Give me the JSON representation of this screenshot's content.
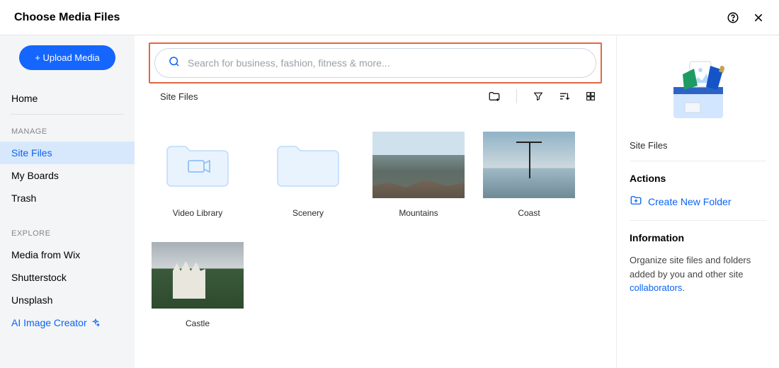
{
  "header": {
    "title": "Choose Media Files"
  },
  "sidebar": {
    "upload_label": "+ Upload Media",
    "home_label": "Home",
    "manage_label": "MANAGE",
    "manage_items": [
      {
        "label": "Site Files",
        "active": true
      },
      {
        "label": "My Boards"
      },
      {
        "label": "Trash"
      }
    ],
    "explore_label": "EXPLORE",
    "explore_items": [
      {
        "label": "Media from Wix"
      },
      {
        "label": "Shutterstock"
      },
      {
        "label": "Unsplash"
      },
      {
        "label": "AI Image Creator",
        "spark": true
      }
    ]
  },
  "search": {
    "placeholder": "Search for business, fashion, fitness & more..."
  },
  "toolbar": {
    "crumb": "Site Files"
  },
  "grid": {
    "items": [
      {
        "label": "Video Library",
        "kind": "folder-video"
      },
      {
        "label": "Scenery",
        "kind": "folder"
      },
      {
        "label": "Mountains",
        "kind": "image-mountains"
      },
      {
        "label": "Coast",
        "kind": "image-coast"
      },
      {
        "label": "Castle",
        "kind": "image-castle"
      }
    ]
  },
  "panel": {
    "title": "Site Files",
    "actions_heading": "Actions",
    "create_folder_label": "Create New Folder",
    "info_heading": "Information",
    "info_text_a": "Organize site files and folders added by you and other site ",
    "info_link": "collaborators",
    "info_text_b": "."
  },
  "colors": {
    "accent": "#0a63f5",
    "upload": "#1566ff",
    "highlight": "#e26645"
  }
}
